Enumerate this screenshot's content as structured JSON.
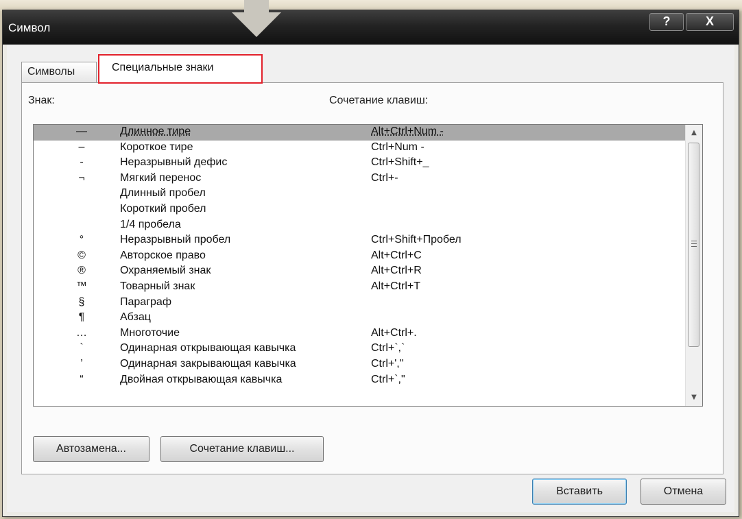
{
  "dialog": {
    "title": "Символ",
    "help_label": "?",
    "close_label": "X"
  },
  "tabs": [
    {
      "label": "Символы"
    },
    {
      "label": "Специальные знаки"
    }
  ],
  "headers": {
    "sign": "Знак:",
    "shortcut": "Сочетание клавиш:"
  },
  "rows": [
    {
      "symbol": "—",
      "name": "Длинное тире",
      "keys": "Alt+Ctrl+Num -"
    },
    {
      "symbol": "–",
      "name": "Короткое тире",
      "keys": "Ctrl+Num -"
    },
    {
      "symbol": "-",
      "name": "Неразрывный дефис",
      "keys": "Ctrl+Shift+_"
    },
    {
      "symbol": "¬",
      "name": "Мягкий перенос",
      "keys": "Ctrl+-"
    },
    {
      "symbol": "",
      "name": "Длинный пробел",
      "keys": ""
    },
    {
      "symbol": "",
      "name": "Короткий пробел",
      "keys": ""
    },
    {
      "symbol": "",
      "name": "1/4 пробела",
      "keys": ""
    },
    {
      "symbol": "°",
      "name": "Неразрывный пробел",
      "keys": "Ctrl+Shift+Пробел"
    },
    {
      "symbol": "©",
      "name": "Авторское право",
      "keys": "Alt+Ctrl+C"
    },
    {
      "symbol": "®",
      "name": "Охраняемый знак",
      "keys": "Alt+Ctrl+R"
    },
    {
      "symbol": "™",
      "name": "Товарный знак",
      "keys": "Alt+Ctrl+T"
    },
    {
      "symbol": "§",
      "name": "Параграф",
      "keys": ""
    },
    {
      "symbol": "¶",
      "name": "Абзац",
      "keys": ""
    },
    {
      "symbol": "…",
      "name": "Многоточие",
      "keys": "Alt+Ctrl+."
    },
    {
      "symbol": "`",
      "name": "Одинарная открывающая кавычка",
      "keys": "Ctrl+`,`"
    },
    {
      "symbol": "’",
      "name": "Одинарная закрывающая кавычка",
      "keys": "Ctrl+',''"
    },
    {
      "symbol": "“",
      "name": "Двойная открывающая кавычка",
      "keys": "Ctrl+`,\""
    }
  ],
  "buttons": {
    "autocorrect": "Автозамена...",
    "shortcut": "Сочетание клавиш...",
    "insert": "Вставить",
    "cancel": "Отмена"
  },
  "colors": {
    "highlight_border": "#e2212b",
    "selected_row": "#a9a9a9"
  },
  "icons": {
    "pointer": "down-arrow-icon",
    "scroll_up": "scroll-up-arrow-icon",
    "scroll_down": "scroll-down-arrow-icon"
  }
}
